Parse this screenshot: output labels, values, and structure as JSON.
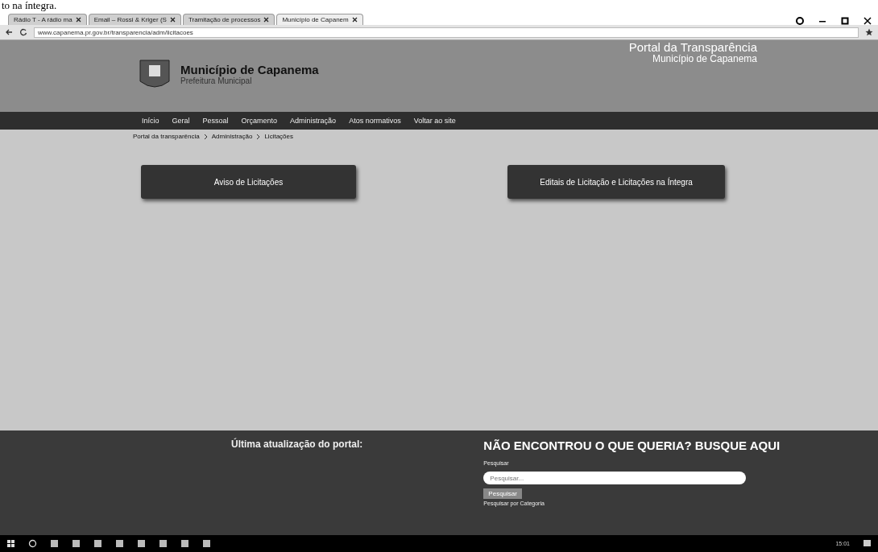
{
  "document_fragment": "to na íntegra.",
  "browser": {
    "tabs": [
      {
        "title": "Rádio T - A rádio ma",
        "selected": false
      },
      {
        "title": "Email – Rossi & Kriger (S",
        "selected": false
      },
      {
        "title": "Tramitação de processos",
        "selected": false
      },
      {
        "title": "Município de Capanem",
        "selected": true
      }
    ],
    "url": "www.capanema.pr.gov.br/transparencia/adm/licitacoes"
  },
  "header": {
    "site_name": "Município de Capanema",
    "site_subtitle": "Prefeitura Municipal",
    "portal_title": "Portal da Transparência",
    "portal_subtitle": "Município de Capanema"
  },
  "nav": [
    "Início",
    "Geral",
    "Pessoal",
    "Orçamento",
    "Administração",
    "Atos normativos",
    "Voltar ao site"
  ],
  "breadcrumb": [
    "Portal da transparência",
    "Administração",
    "Licitações"
  ],
  "buttons": [
    "Aviso de Licitações",
    "Editais de Licitação e Licitações na Íntegra"
  ],
  "footer": {
    "last_update": "Última atualização do portal:",
    "search_heading": "NÃO ENCONTROU O QUE QUERIA? BUSQUE AQUI",
    "search_label": "Pesquisar",
    "search_placeholder": "Pesquisar...",
    "search_button": "Pesquisar",
    "category_link": "Pesquisar por Categoria"
  },
  "taskbar": {
    "time": "15:01"
  }
}
